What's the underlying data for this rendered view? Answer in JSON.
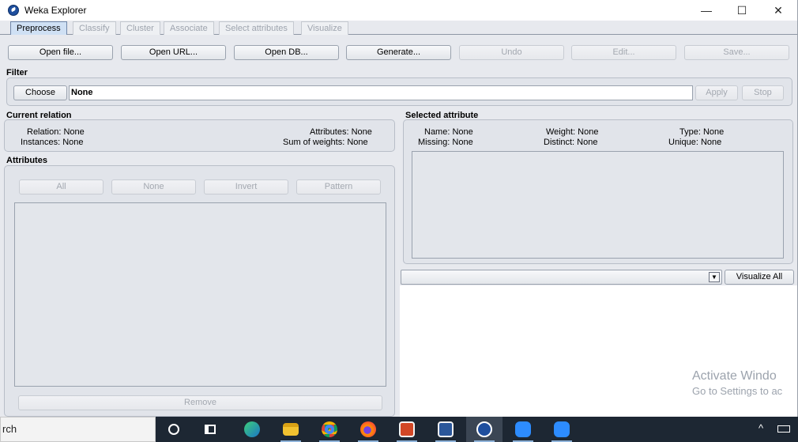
{
  "window": {
    "title": "Weka Explorer",
    "min_glyph": "—",
    "max_glyph": "☐",
    "close_glyph": "✕"
  },
  "tabs": [
    {
      "label": "Preprocess",
      "active": true
    },
    {
      "label": "Classify",
      "active": false
    },
    {
      "label": "Cluster",
      "active": false
    },
    {
      "label": "Associate",
      "active": false
    },
    {
      "label": "Select attributes",
      "active": false
    },
    {
      "label": "Visualize",
      "active": false
    }
  ],
  "toolbar": {
    "open_file": "Open file...",
    "open_url": "Open URL...",
    "open_db": "Open DB...",
    "generate": "Generate...",
    "undo": "Undo",
    "edit": "Edit...",
    "save": "Save..."
  },
  "filter": {
    "label": "Filter",
    "choose": "Choose",
    "value": "None",
    "apply": "Apply",
    "stop": "Stop"
  },
  "current_relation": {
    "label": "Current relation",
    "relation": "Relation: None",
    "instances": "Instances: None",
    "attributes": "Attributes: None",
    "sum_weights": "Sum of weights: None"
  },
  "attributes": {
    "label": "Attributes",
    "all": "All",
    "none": "None",
    "invert": "Invert",
    "pattern": "Pattern",
    "remove": "Remove"
  },
  "selected_attribute": {
    "label": "Selected attribute",
    "name": "Name: None",
    "missing": "Missing: None",
    "weight": "Weight: None",
    "distinct": "Distinct: None",
    "type": "Type: None",
    "unique": "Unique: None"
  },
  "visualize": {
    "combo_value": "",
    "visualize_all": "Visualize All"
  },
  "watermark": {
    "line1": "Activate Windo",
    "line2": "Go to Settings to ac"
  },
  "taskbar": {
    "search_text": "rch",
    "items": [
      "cortana-icon",
      "task-view-icon",
      "edge-icon",
      "file-explorer-icon",
      "chrome-icon",
      "firefox-icon",
      "powerpoint-icon",
      "word-icon",
      "weka-icon",
      "zoom-icon",
      "zoom-meetings-icon"
    ],
    "tray_chevron": "^"
  }
}
